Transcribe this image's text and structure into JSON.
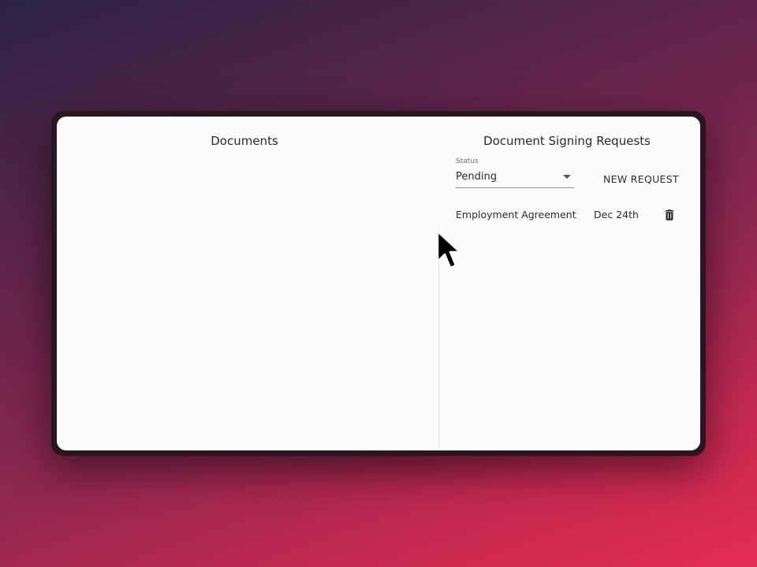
{
  "documents_panel": {
    "title": "Documents"
  },
  "signing_panel": {
    "title": "Document Signing Requests",
    "status_filter": {
      "label": "Status",
      "value": "Pending"
    },
    "new_request_label": "NEW REQUEST",
    "requests": [
      {
        "name": "Employment Agreement",
        "date": "Dec 24th",
        "action_icon": "trash-icon"
      }
    ]
  },
  "colors": {
    "background_start": "#2b2344",
    "background_end": "#e42c55",
    "card": "#fcfcfd",
    "text": "#2b2b2f"
  }
}
